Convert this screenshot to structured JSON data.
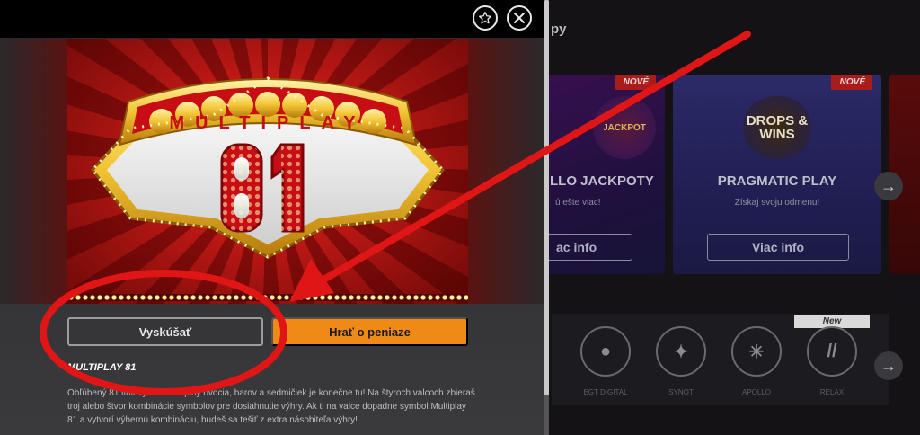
{
  "background": {
    "title_fragment": "py",
    "promo_cards": [
      {
        "id": "jackpot",
        "badge": "NOVÉ",
        "logo_text": "JACKPOT",
        "name": "LLO JACKPOTY",
        "subtitle": "ú ešte viac!",
        "button": "ac info"
      },
      {
        "id": "pragmatic",
        "badge": "NOVÉ",
        "logo_text": "DROPS & WINS",
        "name": "PRAGMATIC PLAY",
        "subtitle": "Získaj svoju odmenu!",
        "button": "Viac info"
      }
    ],
    "providers_new_chip": "New",
    "provider_labels": [
      "EGT DIGITAL",
      "SYNOT",
      "APOLLO",
      "RELAX"
    ]
  },
  "modal": {
    "logo_line1": "MULTIPLAY",
    "logo_line2": "81",
    "try_button": "Vyskúšať",
    "play_money_button": "Hrať o peniaze",
    "game_title": "MULTIPLAY 81",
    "description": "Obľúbený 81 líniový automat plný ovocia, barov a sedmičiek je konečne tu! Na štyroch valcoch zbieraš troj alebo štvor kombinácie symbolov pre dosiahnutie výhry. Ak ti na valce dopadne symbol Multiplay 81 a vytvorí výhernú kombináciu, budeš sa tešiť z extra násobiteľa výhry!"
  },
  "icons": {
    "favorite": "star-icon",
    "close": "close-icon",
    "next": "arrow-right-icon"
  },
  "colors": {
    "accent_orange": "#f08a16",
    "annotation_red": "#e01515"
  }
}
